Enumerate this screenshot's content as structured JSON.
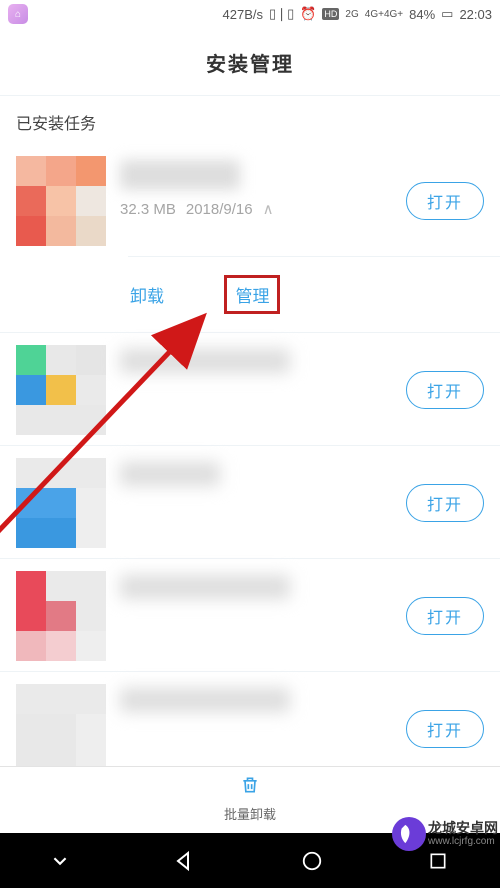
{
  "status": {
    "speed": "427B/s",
    "net2g": "2G",
    "net4g": "4G+4G+",
    "battery": "84%",
    "time": "22:03"
  },
  "page_title": "安装管理",
  "section_header": "已安装任务",
  "buttons": {
    "open": "打开"
  },
  "app0": {
    "size": "32.3 MB",
    "date": "2018/9/16"
  },
  "actions": {
    "uninstall": "卸载",
    "manage": "管理"
  },
  "bottom": {
    "bulk_uninstall": "批量卸载"
  },
  "watermark": {
    "name": "龙城安卓网",
    "url": "www.lcjrfg.com"
  }
}
